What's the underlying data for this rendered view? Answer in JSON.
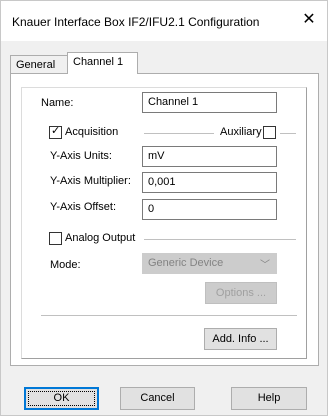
{
  "window": {
    "title": "Knauer Interface Box IF2/IFU2.1 Configuration",
    "close_glyph": "✕"
  },
  "tabs": [
    {
      "label": "General"
    },
    {
      "label": "Channel 1"
    }
  ],
  "form": {
    "name_label": "Name:",
    "name_value": "Channel 1",
    "acquisition_label": "Acquisition",
    "acquisition_checked": true,
    "auxiliary_label": "Auxiliary",
    "auxiliary_checked": false,
    "yunits_label": "Y-Axis Units:",
    "yunits_value": "mV",
    "ymult_label": "Y-Axis Multiplier:",
    "ymult_value": "0,001",
    "yoffset_label": "Y-Axis Offset:",
    "yoffset_value": "0",
    "analog_label": "Analog Output",
    "analog_checked": false,
    "mode_label": "Mode:",
    "mode_value": "Generic Device",
    "options_label": "Options ...",
    "addinfo_label": "Add. Info ..."
  },
  "footer": {
    "ok_label": "OK",
    "cancel_label": "Cancel",
    "help_label": "Help"
  },
  "glyphs": {
    "check": "✓",
    "dropdown": "﹀"
  }
}
